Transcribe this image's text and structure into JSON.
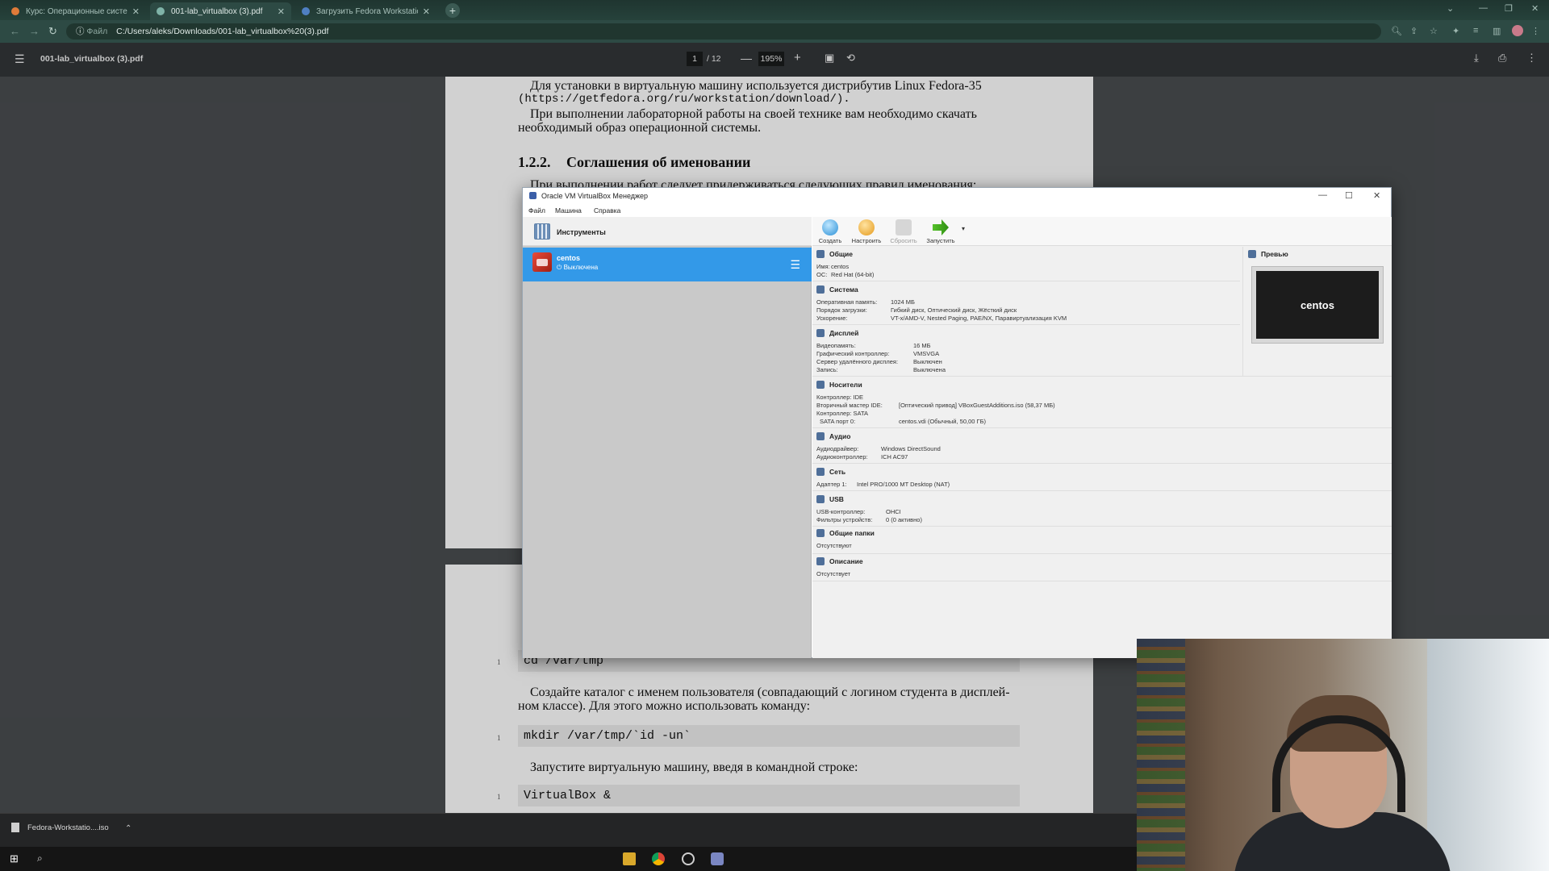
{
  "browser": {
    "tabs": [
      {
        "label": "Курс: Операционные системы"
      },
      {
        "label": "001-lab_virtualbox (3).pdf"
      },
      {
        "label": "Загрузить Fedora Workstation"
      }
    ],
    "url_protocol": "Файл",
    "url": "C:/Users/aleks/Downloads/001-lab_virtualbox%20(3).pdf"
  },
  "pdf_toolbar": {
    "file_name": "001-lab_virtualbox (3).pdf",
    "page_current": "1",
    "page_total": "/ 12",
    "zoom": "195%"
  },
  "pdf_page1": {
    "p1_line1": "Для установки в виртуальную машину используется дистрибутив Linux Fedora-35",
    "p1_line2": "(https://getfedora.org/ru/workstation/download/).",
    "p2_line1": "При выполнении лабораторной работы на своей технике вам необходимо скачать",
    "p2_line2": "необходимый образ операционной системы.",
    "section_number": "1.2.2.",
    "section_title": "Соглашения об именовании",
    "partial_line": "При выполнении работ следует придерживаться следующих правил именования:"
  },
  "pdf_page2": {
    "code1": "cd /var/tmp",
    "text1_line1": "Создайте каталог с именем пользователя (совпадающий с логином студента в дисплей-",
    "text1_line2": "ном классе). Для этого можно использовать команду:",
    "code2": "mkdir /var/tmp/`id -un`",
    "text2": "Запустите виртуальную машину, введя в командной строке:",
    "code3": "VirtualBox &",
    "line_numbers": [
      "1",
      "1",
      "1"
    ]
  },
  "virtualbox": {
    "title": "Oracle VM VirtualBox Менеджер",
    "menu": {
      "file": "Файл",
      "machine": "Машина",
      "help": "Справка"
    },
    "tools_label": "Инструменты",
    "vm": {
      "name": "centos",
      "state": "Выключена"
    },
    "toolbar": {
      "create": "Создать",
      "settings": "Настроить",
      "discard": "Сбросить",
      "start": "Запустить"
    },
    "preview": {
      "title": "Превью",
      "screen_text": "centos"
    },
    "sections": {
      "general": {
        "title": "Общие",
        "rows": [
          {
            "k": "Имя:",
            "v": "centos"
          },
          {
            "k": "ОС:",
            "v": "Red Hat (64-bit)"
          }
        ]
      },
      "system": {
        "title": "Система",
        "rows": [
          {
            "k": "Оперативная память:",
            "v": "1024 МБ"
          },
          {
            "k": "Порядок загрузки:",
            "v": "Гибкий диск, Оптический диск, Жёсткий диск"
          },
          {
            "k": "Ускорение:",
            "v": "VT-x/AMD-V, Nested Paging, PAE/NX, Паравиртуализация KVM"
          }
        ]
      },
      "display": {
        "title": "Дисплей",
        "rows": [
          {
            "k": "Видеопамять:",
            "v": "16 МБ"
          },
          {
            "k": "Графический контроллер:",
            "v": "VMSVGA"
          },
          {
            "k": "Сервер удалённого дисплея:",
            "v": "Выключен"
          },
          {
            "k": "Запись:",
            "v": "Выключена"
          }
        ]
      },
      "storage": {
        "title": "Носители",
        "rows": [
          {
            "k": "Контроллер: IDE",
            "v": ""
          },
          {
            "k": "Вторичный мастер IDE:",
            "v": "[Оптический привод] VBoxGuestAdditions.iso (58,37 МБ)"
          },
          {
            "k": "Контроллер: SATA",
            "v": ""
          },
          {
            "k": "SATA порт 0:",
            "v": "centos.vdi (Обычный, 50,00 ГБ)"
          }
        ]
      },
      "audio": {
        "title": "Аудио",
        "rows": [
          {
            "k": "Аудиодрайвер:",
            "v": "Windows DirectSound"
          },
          {
            "k": "Аудиоконтроллер:",
            "v": "ICH AC97"
          }
        ]
      },
      "network": {
        "title": "Сеть",
        "rows": [
          {
            "k": "Адаптер 1:",
            "v": "Intel PRO/1000 MT Desktop (NAT)"
          }
        ]
      },
      "usb": {
        "title": "USB",
        "rows": [
          {
            "k": "USB-контроллер:",
            "v": "OHCI"
          },
          {
            "k": "Фильтры устройств:",
            "v": "0 (0 активно)"
          }
        ]
      },
      "shared": {
        "title": "Общие папки",
        "rows": [
          {
            "k": "Отсутствуют",
            "v": ""
          }
        ]
      },
      "description": {
        "title": "Описание",
        "rows": [
          {
            "k": "Отсутствует",
            "v": ""
          }
        ]
      }
    }
  },
  "downloads": {
    "item": "Fedora-Workstatio....iso"
  },
  "colors": {
    "accent_selection": "#3399e8",
    "browser_chrome": "#2d4a44",
    "pdf_toolbar": "#323639"
  }
}
